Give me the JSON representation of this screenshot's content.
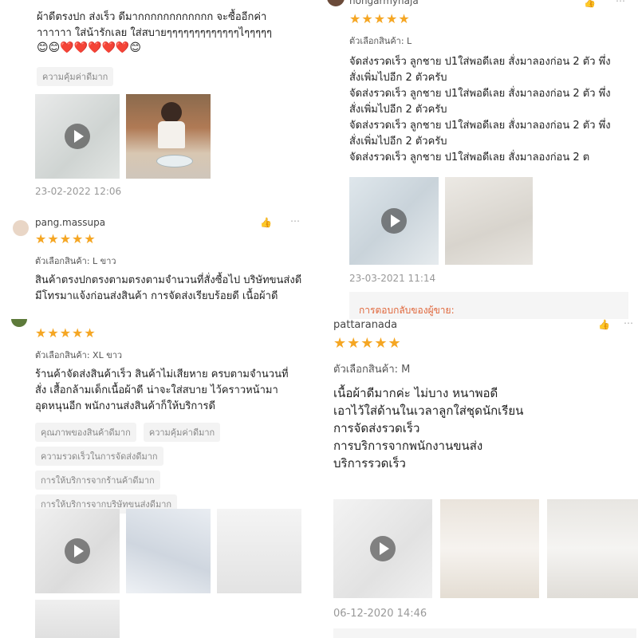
{
  "panel1": {
    "comment": "ผ้าดีตรงปก ส่งเร็ว ดีมากกกกกกกกกกกก จะซื้ออีกค่าาาาาาา ใส่น้ารักเลย ใส่สบายๆๆๆๆๆๆๆๆๆๆๆๆๆไๆๆๆๆๆ",
    "emojis": "😊😊❤️❤️❤️❤️❤️😊",
    "tag": "ความคุ้มค่าดีมาก",
    "date": "23-02-2022 12:06"
  },
  "panel2": {
    "username": "nongarmynaja",
    "rating": "★★★★★",
    "option": "ตัวเลือกสินค้า: L",
    "lines": [
      "จัดส่งรวดเร็ว ลูกชาย ป1ใส่พอดีเลย สั่งมาลองก่อน 2 ตัว พึ่ง",
      "สั่งเพิ่มไปอีก 2 ตัวครับ",
      "จัดส่งรวดเร็ว ลูกชาย ป1ใส่พอดีเลย สั่งมาลองก่อน 2 ตัว พึ่ง",
      "สั่งเพิ่มไปอีก 2 ตัวครับ",
      "จัดส่งรวดเร็ว ลูกชาย ป1ใส่พอดีเลย สั่งมาลองก่อน 2 ตัว พึ่ง",
      "สั่งเพิ่มไปอีก 2 ตัวครับ",
      "จัดส่งรวดเร็ว ลูกชาย ป1ใส่พอดีเลย สั่งมาลองก่อน 2 ต"
    ],
    "date": "23-03-2021 11:14",
    "seller_reply": "การตอบกลับของผู้ขาย:"
  },
  "panel3": {
    "username": "pang.massupa",
    "rating": "★★★★★",
    "option": "ตัวเลือกสินค้า: L ขาว",
    "comment": "สินค้าตรงปกตรงตามตรงตามจำนวนที่สั่งซื้อไป บริษัทขนส่งดี มีโทรมาแจ้งก่อนส่งสินค้า การจัดส่งเรียบร้อยดี เนื้อผ้าดี"
  },
  "panel4": {
    "rating": "★★★★★",
    "option": "ตัวเลือกสินค้า: XL ขาว",
    "comment": "ร้านค้าจัดส่งสินค้าเร็ว สินค้าไม่เสียหาย ครบตามจำนวนที่สั่ง เสื้อกล้ามเด็กเนื้อผ้าดี น่าจะใส่สบาย ไว้คราวหน้ามาอุดหนุนอีก พนักงานส่งสินค้าก็ให้บริการดี",
    "tags": [
      "คุณภาพของสินค้าดีมาก",
      "ความคุ้มค่าดีมาก",
      "ความรวดเร็วในการจัดส่งดีมาก",
      "การให้บริการจากร้านค้าดีมาก",
      "การให้บริการจากบริษัทขนส่งดีมาก"
    ]
  },
  "panel5": {
    "username": "pattaranada",
    "rating": "★★★★★",
    "option": "ตัวเลือกสินค้า: M",
    "lines": [
      "เนื้อผ้าดีมากค่ะ ไม่บาง หนาพอดี",
      "เอาไว้ใส่ด้านในเวลาลูกใส่ชุดนักเรียน",
      "การจัดส่งรวดเร็ว",
      "การบริการจากพนักงานขนส่ง",
      "บริการรวดเร็ว"
    ],
    "date": "06-12-2020 14:46"
  },
  "icons": {
    "like": "thumbs-up-icon",
    "more": "more-icon",
    "play": "play-icon"
  }
}
